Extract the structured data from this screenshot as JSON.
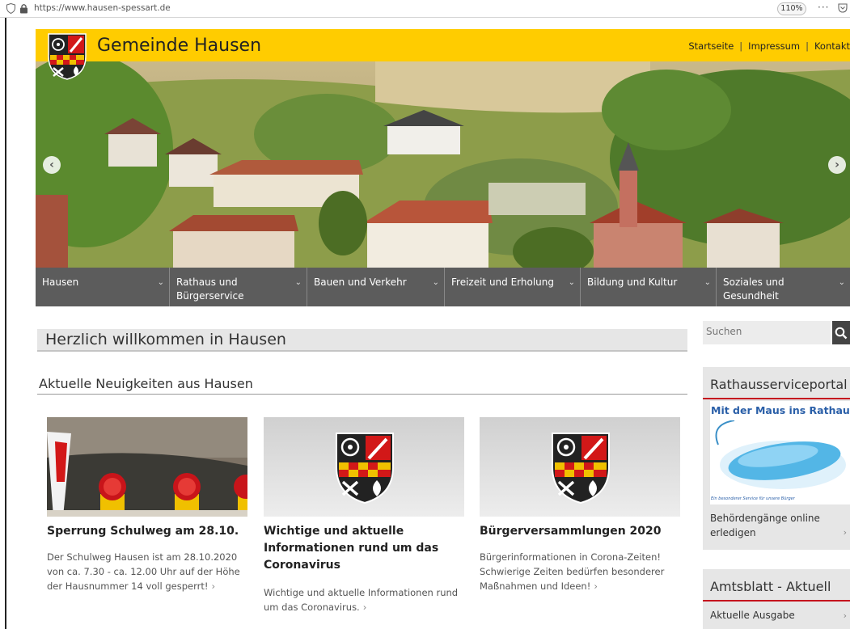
{
  "browser": {
    "url": "https://www.hausen-spessart.de",
    "zoom": "110%",
    "more_label": "···"
  },
  "header": {
    "title": "Gemeinde Hausen",
    "links": [
      "Startseite",
      "Impressum",
      "Kontakt"
    ],
    "background_color": "#ffcc00"
  },
  "hero": {
    "prev_icon": "chevron-left-icon",
    "next_icon": "chevron-right-icon"
  },
  "nav": {
    "items": [
      {
        "label": "Hausen",
        "width": 0
      },
      {
        "label": "Rathaus und Bürgerservice"
      },
      {
        "label": "Bauen und Verkehr"
      },
      {
        "label": "Freizeit und Erholung"
      },
      {
        "label": "Bildung und Kultur"
      },
      {
        "label": "Soziales und Gesundheit"
      }
    ],
    "background_color": "#5c5c5c"
  },
  "main": {
    "welcome_title": "Herzlich willkommen in Hausen",
    "news_title": "Aktuelle Neuigkeiten aus Hausen",
    "cards": [
      {
        "title": "Sperrung Schulweg am 28.10.",
        "text": "Der Schulweg Hausen ist am 28.10.2020 von ca. 7.30 - ca. 12.00 Uhr auf der Höhe der Hausnummer 14 voll gesperrt!",
        "more": "›"
      },
      {
        "title": "Wichtige und aktuelle Informationen rund um das Coronavirus",
        "text": "Wichtige und aktuelle Informationen rund um das Coronavirus.",
        "more": "›"
      },
      {
        "title": "Bürgerversammlungen 2020",
        "text": "Bürgerinformationen in Corona-Zeiten! Schwierige Zeiten bedürfen besonderer Maßnahmen und Ideen!",
        "more": "›"
      }
    ]
  },
  "sidebar": {
    "search_placeholder": "Suchen",
    "portal": {
      "heading": "Rathausserviceportal",
      "banner_title": "Mit der Maus ins Rathaus",
      "banner_caption": "Ein besonderer Service für unsere Bürger",
      "link": "Behördengänge online erledigen"
    },
    "amtsblatt": {
      "heading": "Amtsblatt - Aktuell",
      "link": "Aktuelle Ausgabe"
    },
    "accent_color": "#c5121e"
  }
}
